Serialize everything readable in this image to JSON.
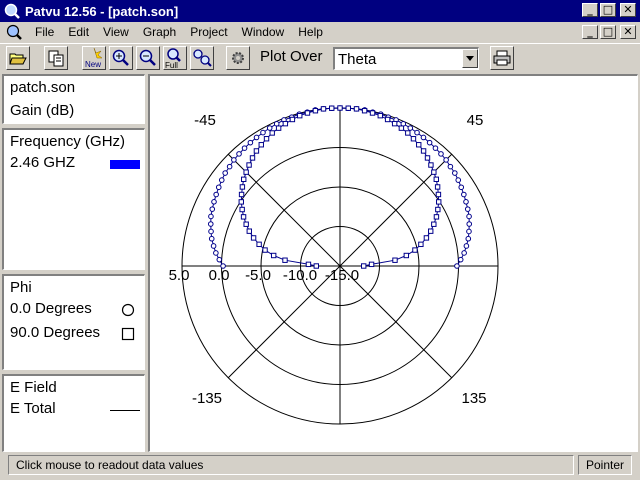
{
  "window": {
    "title": "Patvu 12.56 - [patch.son]"
  },
  "title_buttons": {
    "minimize": "_",
    "maximize": "□",
    "close": "✕"
  },
  "menu": [
    "File",
    "Edit",
    "View",
    "Graph",
    "Project",
    "Window",
    "Help"
  ],
  "toolbar": {
    "plot_over_label": "Plot Over",
    "plot_over_value": "Theta",
    "icons": [
      "open-icon",
      "copy-icon",
      "new-icon",
      "zoom-in-icon",
      "zoom-out-icon",
      "full-icon",
      "zoom-all-icon",
      "settings-icon",
      "print-icon"
    ],
    "new_text": "New",
    "full_text": "Full"
  },
  "left_panel": {
    "file": "patch.son",
    "quantity": "Gain (dB)",
    "frequency_header": "Frequency (GHz)",
    "frequency_value": "2.46 GHZ",
    "frequency_color": "#0000ff",
    "phi_header": "Phi",
    "phi_items": [
      {
        "label": "0.0 Degrees",
        "marker": "circle"
      },
      {
        "label": "90.0 Degrees",
        "marker": "square"
      }
    ],
    "field_header": "E Field",
    "field_value": "E Total"
  },
  "chart_data": {
    "type": "polar",
    "angle_labels": [
      "-45",
      "45",
      "-135",
      "135"
    ],
    "radial_labels": [
      "5.0",
      "0.0",
      "-5.0",
      "-10.0",
      "-15.0"
    ],
    "r_range": [
      -15,
      5
    ],
    "series_color": "#00008b",
    "series": [
      {
        "marker": "circle",
        "theta": [
          -90,
          -87,
          -84,
          -81,
          -78,
          -75,
          -72,
          -69,
          -66,
          -63,
          -60,
          -57,
          -54,
          -51,
          -48,
          -45,
          -42,
          -39,
          -36,
          -33,
          -30,
          -27,
          -24,
          -21,
          -18,
          -15,
          -12,
          -9,
          -6,
          -3,
          0,
          3,
          6,
          9,
          12,
          15,
          18,
          21,
          24,
          27,
          30,
          33,
          36,
          39,
          42,
          45,
          48,
          51,
          54,
          57,
          60,
          63,
          66,
          69,
          72,
          75,
          78,
          81,
          84,
          87,
          90
        ],
        "gain": [
          -0.2,
          0.3,
          0.8,
          1.2,
          1.6,
          1.9,
          2.2,
          2.5,
          2.7,
          2.9,
          3.1,
          3.3,
          3.5,
          3.7,
          3.8,
          4.0,
          4.1,
          4.2,
          4.3,
          4.4,
          4.5,
          4.6,
          4.7,
          4.8,
          4.8,
          4.9,
          4.9,
          5.0,
          5.0,
          5.0,
          5.0,
          5.0,
          5.0,
          5.0,
          4.9,
          4.9,
          4.8,
          4.8,
          4.7,
          4.6,
          4.5,
          4.4,
          4.3,
          4.2,
          4.1,
          4.0,
          3.8,
          3.7,
          3.5,
          3.3,
          3.1,
          2.9,
          2.7,
          2.5,
          2.2,
          1.9,
          1.6,
          1.2,
          0.8,
          0.3,
          -0.2
        ]
      },
      {
        "marker": "square",
        "theta": [
          -90,
          -87,
          -84,
          -81,
          -78,
          -75,
          -72,
          -69,
          -66,
          -63,
          -60,
          -57,
          -54,
          -51,
          -48,
          -45,
          -42,
          -39,
          -36,
          -33,
          -30,
          -27,
          -24,
          -21,
          -18,
          -15,
          -12,
          -9,
          -6,
          -3,
          0,
          3,
          6,
          9,
          12,
          15,
          18,
          21,
          24,
          27,
          30,
          33,
          36,
          39,
          42,
          45,
          48,
          51,
          54,
          57,
          60,
          63,
          66,
          69,
          72,
          75,
          78,
          81,
          84,
          87,
          90
        ],
        "gain": [
          -12.0,
          -11.0,
          -8.0,
          -6.5,
          -5.3,
          -4.4,
          -3.5,
          -2.7,
          -2.0,
          -1.3,
          -0.7,
          -0.1,
          0.4,
          0.9,
          1.4,
          1.8,
          2.2,
          2.6,
          3.0,
          3.3,
          3.6,
          3.9,
          4.1,
          4.3,
          4.5,
          4.7,
          4.8,
          4.9,
          5.0,
          5.0,
          5.0,
          5.0,
          5.0,
          4.9,
          4.8,
          4.7,
          4.5,
          4.3,
          4.1,
          3.9,
          3.6,
          3.3,
          3.0,
          2.6,
          2.2,
          1.8,
          1.4,
          0.9,
          0.4,
          -0.1,
          -0.7,
          -1.3,
          -2.0,
          -2.7,
          -3.5,
          -4.4,
          -5.3,
          -6.5,
          -8.0,
          -11.0,
          -12.0
        ]
      }
    ]
  },
  "status": {
    "message": "Click mouse to readout data values",
    "mode": "Pointer"
  }
}
